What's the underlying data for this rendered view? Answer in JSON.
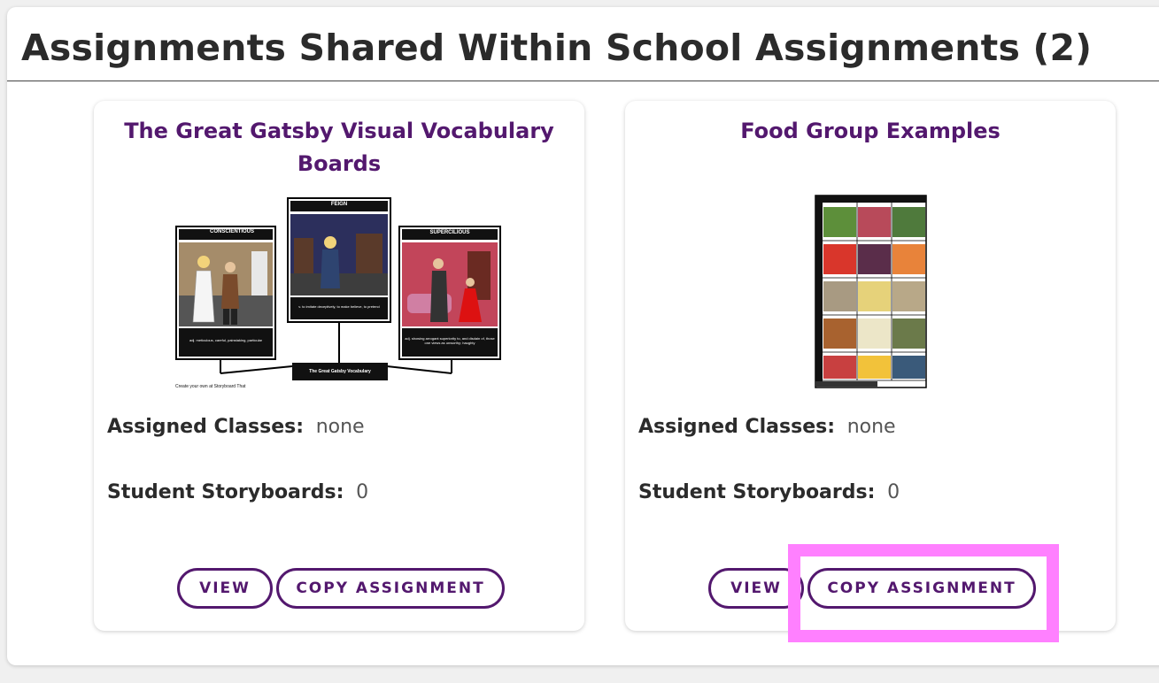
{
  "section": {
    "title": "Assignments Shared Within School Assignments (2)"
  },
  "cards": [
    {
      "title": "The Great Gatsby Visual Vocabulary Boards",
      "thumbnail": {
        "cells": [
          {
            "word": "CONSCIENTIOUS",
            "definition": "adj. meticulous, careful, painstaking, particular"
          },
          {
            "word": "FEIGN",
            "definition": "v. to imitate deceptively, to make believe, to pretend"
          },
          {
            "word": "SUPERCILIOUS",
            "definition": "adj. showing arrogant superiority to, and disdain of, those one views as unworthy; haughty"
          }
        ],
        "footer": "The Great Gatsby Vocabulary",
        "credit": "Create your own at Storyboard That"
      },
      "assigned_classes_label": "Assigned Classes:",
      "assigned_classes_value": "none",
      "student_storyboards_label": "Student Storyboards:",
      "student_storyboards_value": "0",
      "view_label": "VIEW",
      "copy_label": "COPY ASSIGNMENT"
    },
    {
      "title": "Food Group Examples",
      "assigned_classes_label": "Assigned Classes:",
      "assigned_classes_value": "none",
      "student_storyboards_label": "Student Storyboards:",
      "student_storyboards_value": "0",
      "view_label": "VIEW",
      "copy_label": "COPY ASSIGNMENT"
    }
  ],
  "colors": {
    "accent": "#53186e",
    "highlight": "#ff80ff"
  }
}
